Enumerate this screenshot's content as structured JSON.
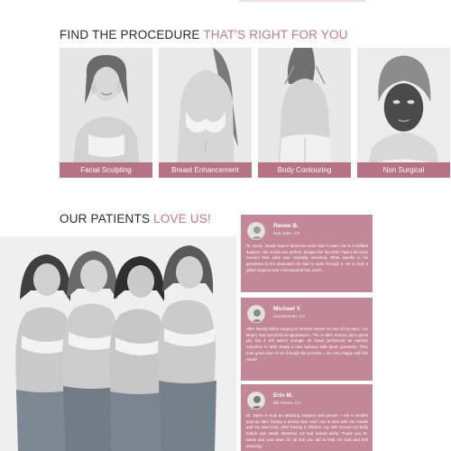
{
  "procedures": {
    "title_main": "FIND THE PROCEDURE ",
    "title_accent": "THAT'S RIGHT FOR YOU",
    "cards": [
      {
        "label": "Facial Sculpting"
      },
      {
        "label": "Breast Enhancement"
      },
      {
        "label": "Body Contouring"
      },
      {
        "label": "Non Surgical"
      }
    ]
  },
  "patients": {
    "title_main": "OUR PATIENTS ",
    "title_accent": "LOVE US!"
  },
  "reviews": [
    {
      "name": "Renee B.",
      "location": "San Jose, CA",
      "text": "Dr. Davis, hands down!! deserves more than 5 stars. He is a brilliant surgeon. My results are perfect, despite the fact that I had a lot more needed than what was originally assumed. What speaks to his greatness is the dedication he had to work through it. He is truly a gifted surgeon and I recommend him 110%."
    },
    {
      "name": "Michael Y.",
      "location": "Sacramento, CA",
      "text": "After having Moho surgery to remove cancer on one of my ears, I no longer had symmetrical appearance. The 4 other doctors did a great job, but it still wasn't enough. Dr Davis performed an earlobe reduction to help create a new balance with great symmetry. They took great care of me through the process. I am very happy with the result!"
    },
    {
      "name": "Erin M.",
      "location": "Elk Grove, CA",
      "text": "Dr. Davis is truly an amazing surgeon and person. I am 6 months post-op after having a tummy tuck and I am in love with the results and my new body. After having 3 children, my skin around my belly button was totally stretched out and looked awful. Thank you Dr. Davis and your team for all that you did to help me look and feel amazing."
    }
  ],
  "colors": {
    "accent": "#c07a8c",
    "card_label_bg": "#b57385",
    "review_bg": "#c3879a"
  }
}
